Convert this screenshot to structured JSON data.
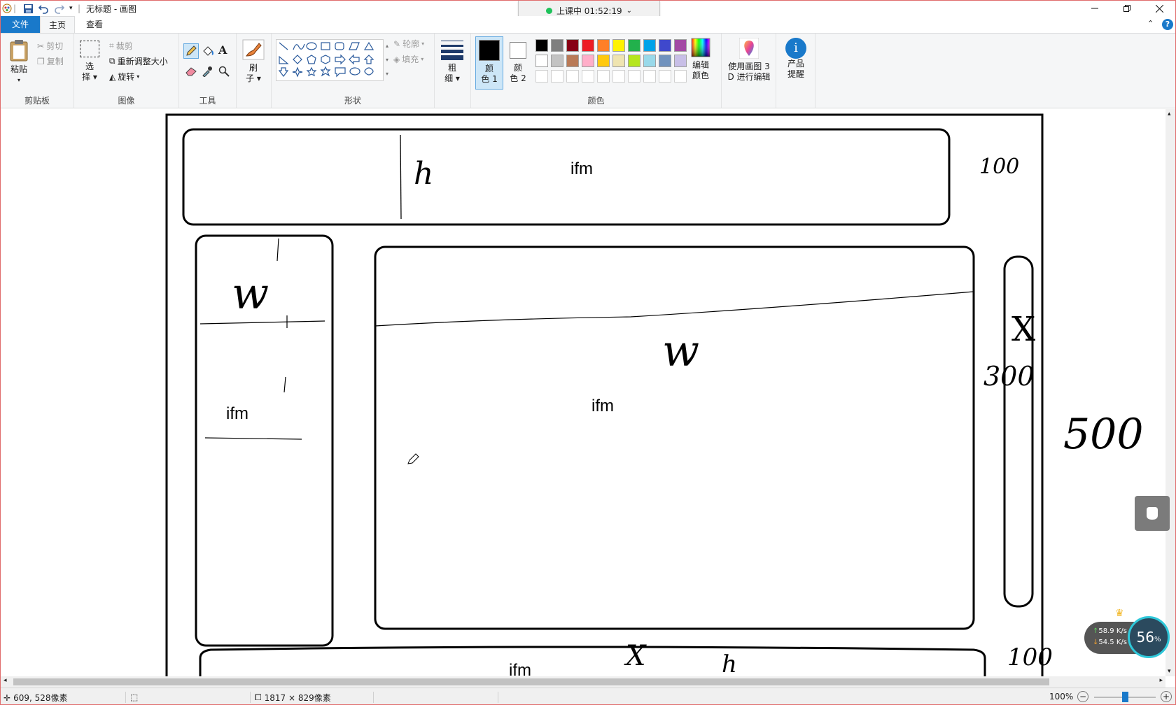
{
  "window": {
    "title": "无标题 - 画图",
    "class_status": "上课中 01:52:19"
  },
  "tabs": [
    {
      "label": "文件"
    },
    {
      "label": "主页"
    },
    {
      "label": "查看"
    }
  ],
  "ribbon": {
    "clipboard": {
      "paste": "粘贴",
      "cut": "剪切",
      "copy": "复制",
      "group": "剪贴板"
    },
    "image": {
      "select_1": "选",
      "select_2": "择",
      "crop": "裁剪",
      "resize": "重新调整大小",
      "rotate": "旋转",
      "group": "图像"
    },
    "tools": {
      "group": "工具"
    },
    "brushes": {
      "label_1": "刷",
      "label_2": "子"
    },
    "shapes": {
      "outline": "轮廓",
      "fill": "填充",
      "group": "形状"
    },
    "size": {
      "label_1": "粗",
      "label_2": "细"
    },
    "colors": {
      "color1_a": "颜",
      "color1_b": "色 1",
      "color2_a": "颜",
      "color2_b": "色 2",
      "edit_a": "编辑",
      "edit_b": "颜色",
      "group": "颜色",
      "color1": "#000000",
      "color2": "#ffffff",
      "palette_row1": [
        "#000000",
        "#7f7f7f",
        "#880015",
        "#ed1c24",
        "#ff7f27",
        "#fff200",
        "#22b14c",
        "#00a2e8",
        "#3f48cc",
        "#a349a4"
      ],
      "palette_row2": [
        "#ffffff",
        "#c3c3c3",
        "#b97a57",
        "#ffaec9",
        "#ffc90e",
        "#efe4b0",
        "#b5e61d",
        "#99d9ea",
        "#7092be",
        "#c8bfe7"
      ],
      "palette_row3": [
        "#ffffff",
        "#ffffff",
        "#ffffff",
        "#ffffff",
        "#ffffff",
        "#ffffff",
        "#ffffff",
        "#ffffff",
        "#ffffff",
        "#ffffff"
      ]
    },
    "paint3d": {
      "label_1": "使用画图 3",
      "label_2": "D 进行编辑"
    },
    "product": {
      "label_1": "产品",
      "label_2": "提醒"
    }
  },
  "canvas": {
    "text_top": "ifm",
    "text_left": "ifm",
    "text_center": "ifm",
    "text_bottom": "ifm",
    "hw_h": "h",
    "hw_w1": "w",
    "hw_w2": "w",
    "hw_x": "X",
    "hw_100_top": "100",
    "hw_300": "300",
    "hw_500": "500",
    "hw_100_bottom": "100",
    "hw_x2": "X",
    "hw_h2": "h"
  },
  "status": {
    "cursor_pos": "609, 528像素",
    "canvas_size": "1817 × 829像素",
    "zoom": "100%"
  },
  "netmon": {
    "up": "58.9 K/s",
    "down": "54.5 K/s",
    "percent": "56",
    "unit": "%"
  }
}
